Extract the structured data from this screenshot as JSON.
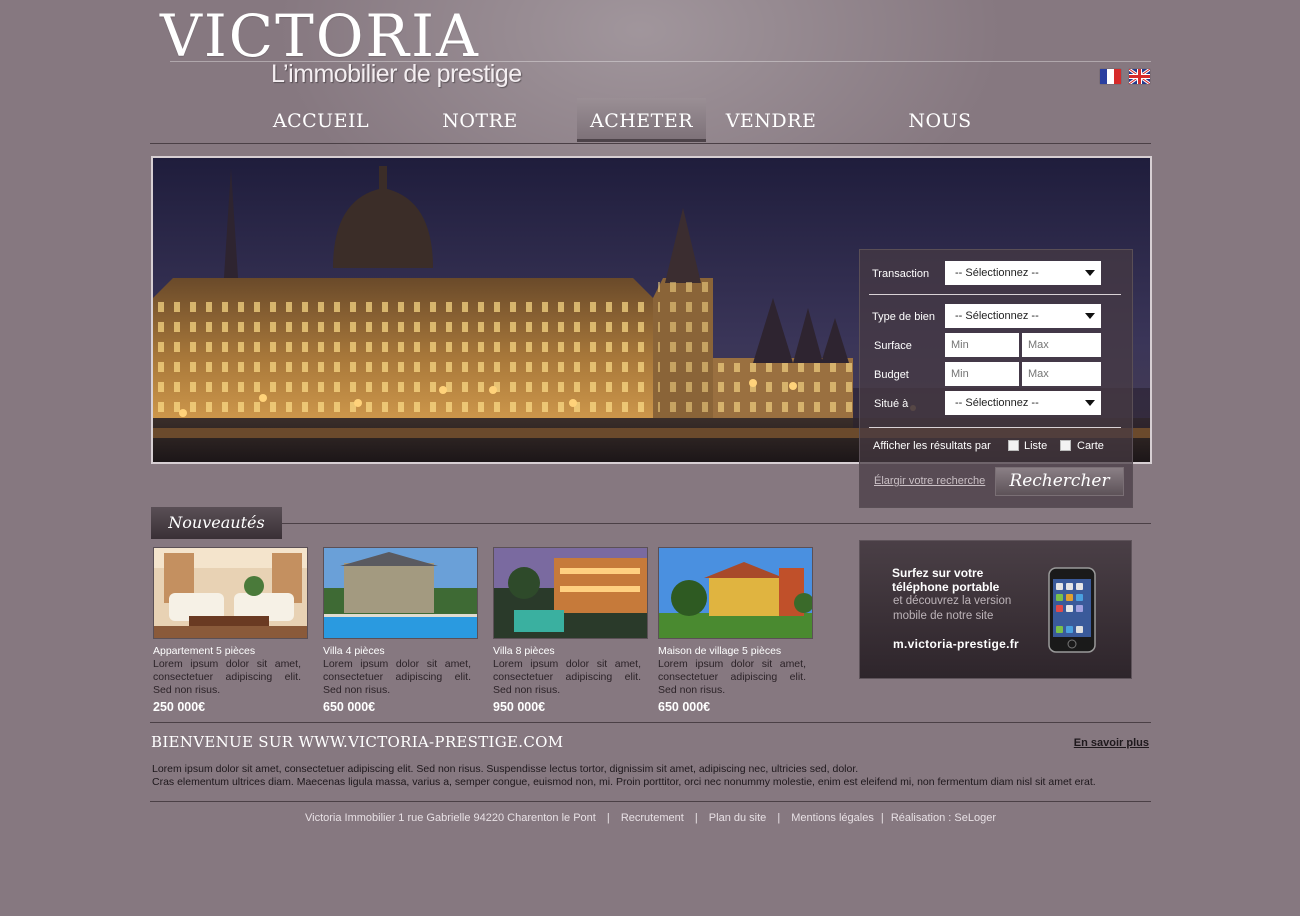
{
  "brand": {
    "name": "VICTORIA",
    "tagline": "L’immobilier de prestige"
  },
  "languages": [
    {
      "code": "fr",
      "icon": "flag-fr-icon"
    },
    {
      "code": "en",
      "icon": "flag-uk-icon"
    }
  ],
  "nav": {
    "items": [
      {
        "label": "ACCUEIL"
      },
      {
        "label": "NOTRE AGENCE"
      },
      {
        "label": "ACHETER"
      },
      {
        "label": "VENDRE"
      },
      {
        "label": "NOUS CONTACTER"
      }
    ],
    "active": "ACHETER"
  },
  "search": {
    "transaction_label": "Transaction",
    "transaction_value": "-- Sélectionnez --",
    "type_label": "Type de bien",
    "type_value": "-- Sélectionnez --",
    "surface_label": "Surface",
    "surface_min_placeholder": "Min",
    "surface_max_placeholder": "Max",
    "budget_label": "Budget",
    "budget_min_placeholder": "Min",
    "budget_max_placeholder": "Max",
    "location_label": "Situé à",
    "location_value": "-- Sélectionnez --",
    "display_label": "Afficher les résultats par",
    "option_list": "Liste",
    "option_map": "Carte",
    "widen_link": "Élargir votre recherche",
    "submit_label": "Rechercher"
  },
  "news": {
    "heading": "Nouveautés",
    "cards": [
      {
        "title": "Appartement 5 pièces",
        "desc": "Lorem ipsum dolor sit amet, consectetuer adipiscing elit. Sed non risus.",
        "price": "250 000€"
      },
      {
        "title": "Villa 4 pièces",
        "desc": "Lorem ipsum dolor sit amet, consectetuer adipiscing elit. Sed non risus.",
        "price": "650 000€"
      },
      {
        "title": "Villa 8 pièces",
        "desc": "Lorem ipsum dolor sit amet, consectetuer adipiscing elit. Sed non risus.",
        "price": "950 000€"
      },
      {
        "title": "Maison de village 5 pièces",
        "desc": "Lorem ipsum dolor sit amet, consectetuer adipiscing elit. Sed non risus.",
        "price": "650 000€"
      }
    ]
  },
  "promo": {
    "title": "Surfez sur votre téléphone portable",
    "subtitle": "et découvrez la version mobile de notre site",
    "url": "m.victoria-prestige.fr"
  },
  "welcome": {
    "title": "BIENVENUE SUR WWW.VICTORIA-PRESTIGE.COM",
    "more_label": "En savoir plus",
    "line1": "Lorem ipsum dolor sit amet, consectetuer adipiscing elit. Sed non risus. Suspendisse lectus tortor, dignissim sit amet, adipiscing nec, ultricies sed, dolor.",
    "line2": "Cras elementum ultrices diam. Maecenas ligula massa, varius a, semper congue, euismod non, mi. Proin porttitor, orci nec nonummy molestie, enim est eleifend mi, non fermentum diam nisl sit amet erat."
  },
  "footer": {
    "address": "Victoria Immobilier 1 rue Gabrielle 94220 Charenton le Pont",
    "recruitment": "Recrutement",
    "sitemap": "Plan du site",
    "legal": "Mentions légales",
    "credit": "Réalisation : SeLoger"
  },
  "colors": {
    "background": "#867880",
    "accent_dark": "#3a3036",
    "text_light": "#ffffff"
  }
}
